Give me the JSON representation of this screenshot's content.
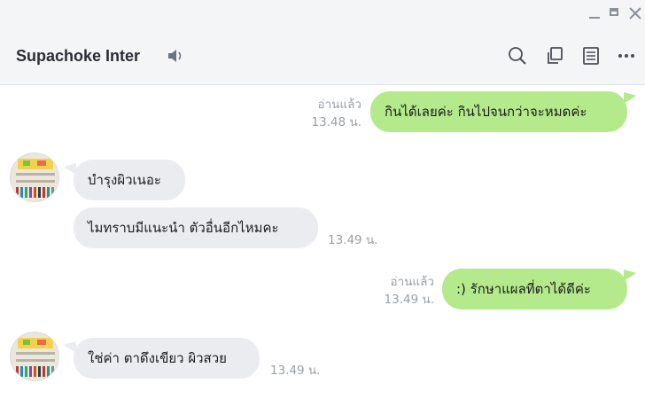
{
  "window": {
    "controls": [
      "minimize",
      "maximize",
      "close"
    ]
  },
  "header": {
    "chat_name": "Supachoke Inter",
    "icons": [
      "speaker-icon",
      "search-icon",
      "copy-icon",
      "notes-icon",
      "more-icon"
    ]
  },
  "colors": {
    "outgoing_bubble": "#b4ea8c",
    "incoming_bubble": "#eaecef",
    "meta_text": "#9aa0a6"
  },
  "messages": [
    {
      "direction": "outgoing",
      "text": "กินได้เลยค่ะ กินไปจนกว่าจะหมดค่ะ",
      "read_status": "อ่านแล้ว",
      "time": "13.48 น."
    },
    {
      "direction": "incoming",
      "text": "บำรุงผิวเนอะ"
    },
    {
      "direction": "incoming",
      "text": "ไมทราบมีแนะนำ ตัวอื่นอีกไหมคะ",
      "time": "13.49 น."
    },
    {
      "direction": "outgoing",
      "text": ":) รักษาแผลที่ตาได้ดีค่ะ",
      "read_status": "อ่านแล้ว",
      "time": "13.49 น."
    },
    {
      "direction": "incoming",
      "text": "ใช่ค่า ตาดึงเขียว ผิวสวย",
      "time": "13.49 น."
    }
  ]
}
